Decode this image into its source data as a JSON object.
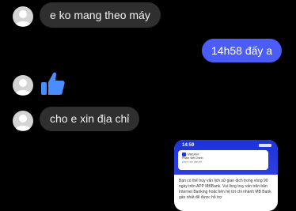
{
  "messages": [
    {
      "text": "e ko mang theo máy"
    },
    {
      "text": "14h58 đấy a"
    },
    {
      "text": "cho e xin địa chỉ"
    }
  ],
  "screenshot_image": {
    "status_time": "14:59",
    "header_small": "MBBANK",
    "sender_name": "Phạm Viết Chính",
    "sender_sub": "cho e xin địa chỉ",
    "body_text": "Bạn có thể truy vấn lịch sử giao dịch trong vòng 90 ngày trên APP MBBank. Vui lòng truy vấn trên bản Internet Banking hoặc liên hệ tới chi nhánh MB Bank gần nhất để được hỗ trợ"
  },
  "icons": {
    "avatar": "default-avatar-icon",
    "like": "thumbs-up-icon"
  },
  "colors": {
    "background": "#000000",
    "incoming_bubble": "#2f2f2f",
    "outgoing_bubble": "#4b5cf7",
    "like_icon": "#4a8dff"
  }
}
